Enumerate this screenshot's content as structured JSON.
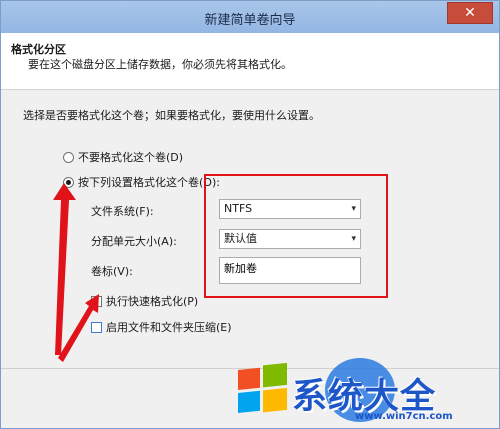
{
  "window": {
    "title": "新建简单卷向导",
    "close_glyph": "✕"
  },
  "header": {
    "title": "格式化分区",
    "subtitle": "要在这个磁盘分区上储存数据，你必须先将其格式化。"
  },
  "prompt": "选择是否要格式化这个卷；如果要格式化，要使用什么设置。",
  "options": {
    "no_format": {
      "label": "不要格式化这个卷(D)",
      "checked": false
    },
    "format": {
      "label": "按下列设置格式化这个卷(O):",
      "checked": true
    }
  },
  "fields": {
    "filesystem": {
      "label": "文件系统(F):",
      "value": "NTFS"
    },
    "allocation": {
      "label": "分配单元大小(A):",
      "value": "默认值"
    },
    "volume_label": {
      "label": "卷标(V):",
      "value": "新加卷"
    }
  },
  "checks": {
    "quick_format": {
      "label": "执行快速格式化(P)",
      "checked": true
    },
    "compression": {
      "label": "启用文件和文件夹压缩(E)",
      "checked": false
    }
  },
  "watermark": {
    "brand": "系统大全",
    "url": "www.win7cn.com"
  },
  "colors": {
    "annotation": "#e0131a",
    "titlebar": "#a9c6ea",
    "brand": "#1c56c9"
  }
}
